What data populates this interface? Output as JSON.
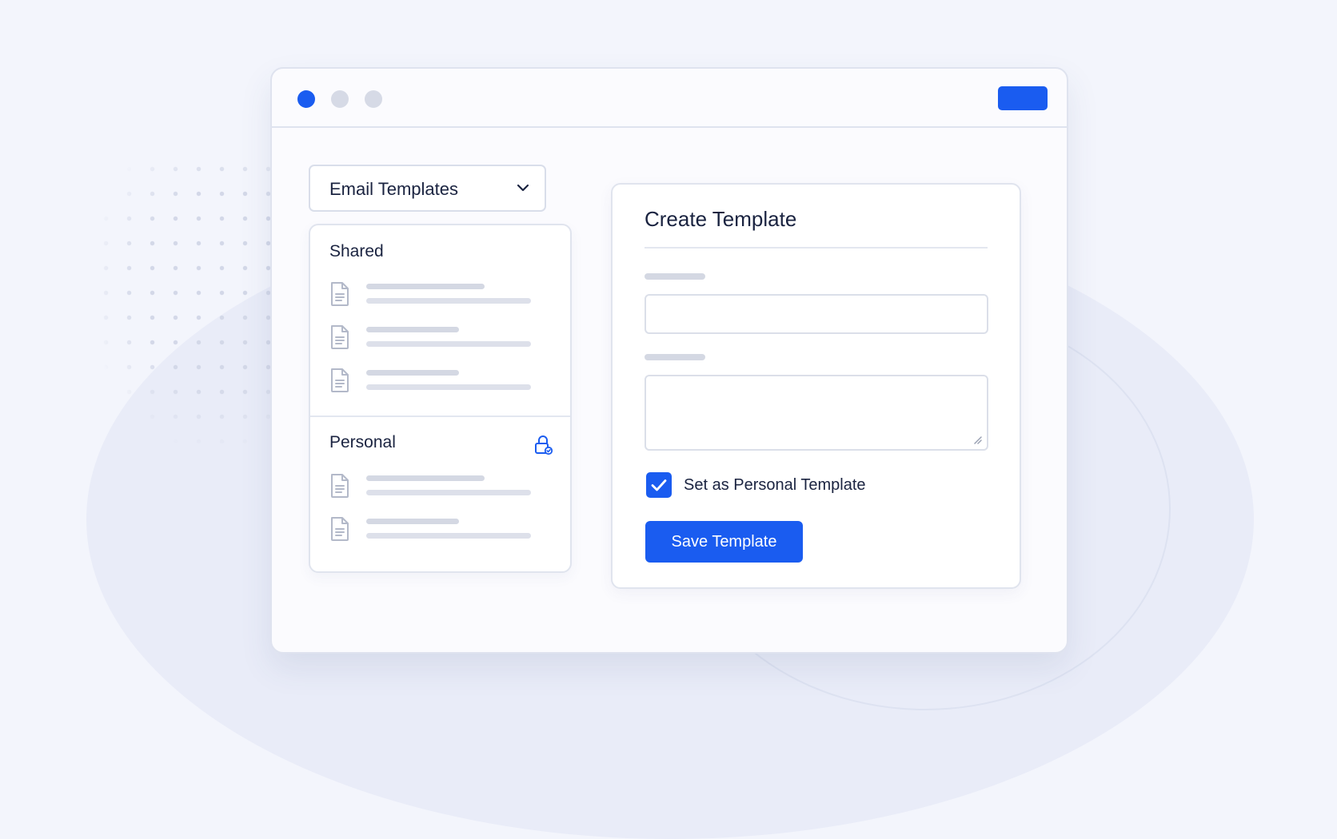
{
  "window": {
    "controls": [
      "close",
      "minimize",
      "maximize"
    ]
  },
  "sidebar": {
    "dropdown": {
      "label": "Email Templates",
      "icon": "chevron-down-icon"
    },
    "sections": {
      "shared": {
        "label": "Shared",
        "items": [
          {
            "icon": "document-icon"
          },
          {
            "icon": "document-icon"
          },
          {
            "icon": "document-icon"
          }
        ]
      },
      "personal": {
        "label": "Personal",
        "icon": "lock-icon",
        "items": [
          {
            "icon": "document-icon"
          },
          {
            "icon": "document-icon"
          }
        ]
      }
    }
  },
  "form": {
    "title": "Create Template",
    "name_value": "",
    "body_value": "",
    "personal_checkbox": {
      "label": "Set as Personal Template",
      "checked": true
    },
    "save_label": "Save Template"
  },
  "colors": {
    "accent": "#1a5cf0",
    "background": "#f3f5fc",
    "text": "#1a2340",
    "placeholder_bar": "#d4d8e3"
  }
}
